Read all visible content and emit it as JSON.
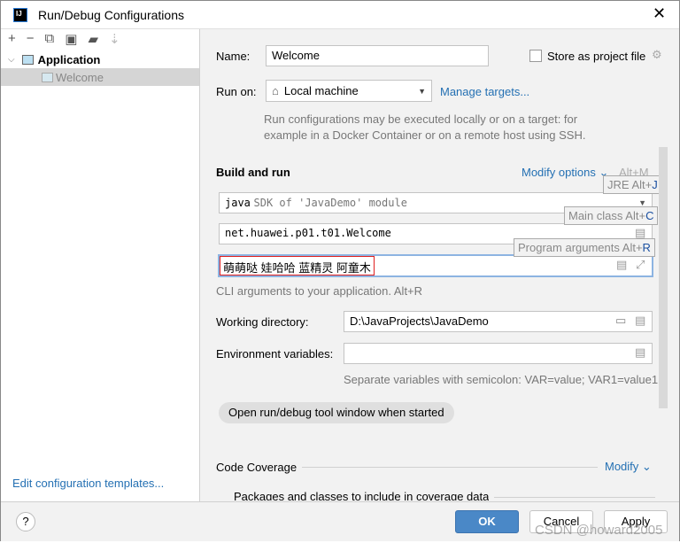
{
  "window": {
    "title": "Run/Debug Configurations",
    "logo": "IJ"
  },
  "toolbar": {
    "icons": [
      "plus-icon",
      "minus-icon",
      "copy-icon",
      "save-icon",
      "folder-add-icon",
      "sort-icon"
    ]
  },
  "tree": {
    "group": "Application",
    "item": "Welcome"
  },
  "left_footer": {
    "edit_templates": "Edit configuration templates..."
  },
  "form": {
    "name_label": "Name:",
    "name_value": "Welcome",
    "store_label": "Store as project file",
    "run_on_label": "Run on:",
    "run_on_value": "Local machine",
    "manage_targets": "Manage targets...",
    "run_on_hint": "Run configurations may be executed locally or on a target: for example in a Docker Container or on a remote host using SSH.",
    "build_run": "Build and run",
    "modify_options": "Modify options",
    "modify_shortcut": "Alt+M",
    "jre_bold": "java",
    "jre_rest": "SDK of 'JavaDemo' module",
    "main_class": "net.huawei.p01.t01.Welcome",
    "program_args": "萌萌哒 娃哈哈 蓝精灵 阿童木",
    "args_hint": "CLI arguments to your application. Alt+R",
    "workdir_label": "Working directory:",
    "workdir_value": "D:\\JavaProjects\\JavaDemo",
    "env_label": "Environment variables:",
    "env_value": "",
    "env_hint": "Separate variables with semicolon: VAR=value; VAR1=value1",
    "open_tool_window": "Open run/debug tool window when started",
    "code_coverage": "Code Coverage",
    "modify": "Modify",
    "packages": "Packages and classes to include in coverage data"
  },
  "tooltips": {
    "jre": "JRE Alt+",
    "jre_key": "J",
    "main": "Main class Alt+",
    "main_key": "C",
    "args": "Program arguments Alt+",
    "args_key": "R"
  },
  "footer": {
    "help": "?",
    "ok": "OK",
    "cancel": "Cancel",
    "apply": "Apply"
  },
  "watermark": "CSDN @howard2005",
  "colors": {
    "accent": "#2470b3",
    "ok_button": "#4a88c7",
    "highlight_border": "#e02020"
  }
}
